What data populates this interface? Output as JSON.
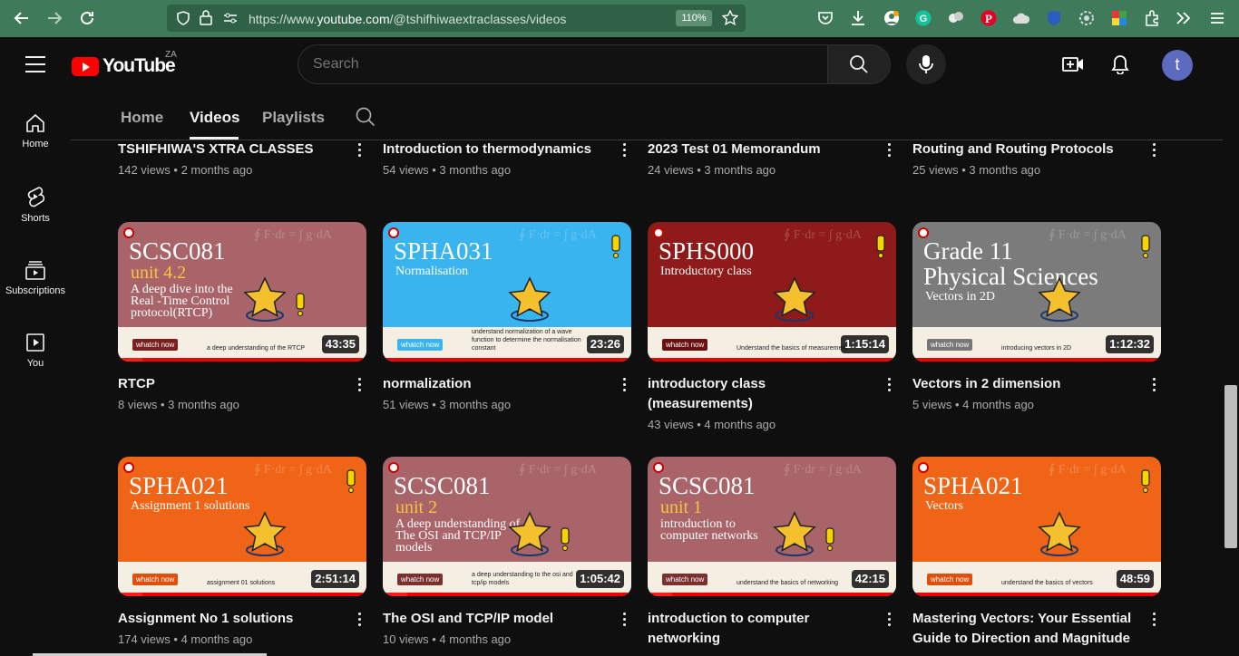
{
  "browser": {
    "url_prefix": "https://www.",
    "url_host": "youtube.com",
    "url_path": "/@tshifhiwaextraclasses/videos",
    "zoom": "110%"
  },
  "header": {
    "logo_text": "YouTube",
    "country": "ZA",
    "search_placeholder": "Search",
    "avatar_letter": "t"
  },
  "sidebar": {
    "items": [
      {
        "label": "Home",
        "icon": "home-icon"
      },
      {
        "label": "Shorts",
        "icon": "shorts-icon"
      },
      {
        "label": "Subscriptions",
        "icon": "subscriptions-icon"
      },
      {
        "label": "You",
        "icon": "you-icon"
      }
    ]
  },
  "tabs": [
    {
      "label": "Home",
      "active": false
    },
    {
      "label": "Videos",
      "active": true
    },
    {
      "label": "Playlists",
      "active": false
    }
  ],
  "top_row": [
    {
      "title": "TSHIFHIWA'S XTRA CLASSES",
      "meta": "142 views • 2 months ago"
    },
    {
      "title": "Introduction to thermodynamics",
      "meta": "54 views • 3 months ago"
    },
    {
      "title": "2023 Test 01 Memorandum",
      "meta": "24 views • 3 months ago"
    },
    {
      "title": "Routing and Routing Protocols",
      "meta": "25 views • 3 months ago"
    }
  ],
  "row2": [
    {
      "title": "RTCP",
      "meta": "8 views • 3 months ago",
      "duration": "43:35",
      "thumb": {
        "big": "SCSC081",
        "unit": "unit 4.2",
        "sub": "A deep dive into the\nReal -Time Control\nprotocol(RTCP)",
        "watch": "whatch now",
        "strip": "a deep understanding of the RTCP",
        "bg": "#a86468",
        "watch_bg": "#7a2020",
        "progress": 0.1
      }
    },
    {
      "title": "normalization",
      "meta": "51 views • 3 months ago",
      "duration": "23:26",
      "thumb": {
        "big": "SPHA031",
        "unit": "",
        "sub": "Normalisation",
        "watch": "whatch now",
        "strip": "understand normalization of a wave function to determine the normalisation constant",
        "bg": "#3ab4ef",
        "watch_bg": "#3ab4ef",
        "progress": 0
      }
    },
    {
      "title": "introductory class (measurements)",
      "meta": "43 views • 4 months ago",
      "duration": "1:15:14",
      "thumb": {
        "big": "SPHS000",
        "unit": "",
        "sub": "Introductory class",
        "watch": "whatch now",
        "strip": "Understand the basics of measurement",
        "bg": "#8e1a1a",
        "watch_bg": "#6a1010",
        "progress": 0
      }
    },
    {
      "title": "Vectors in 2 dimension",
      "meta": "5 views • 4 months ago",
      "duration": "1:12:32",
      "thumb": {
        "big": "Grade 11",
        "big2": "Physical Sciences",
        "unit": "",
        "sub": "Vectors in 2D",
        "watch": "whatch now",
        "strip": "introducing vectors in 2D",
        "bg": "#7b7b7b",
        "watch_bg": "#777777",
        "progress": 0
      }
    }
  ],
  "row3": [
    {
      "title": "Assignment No 1 solutions",
      "meta": "174 views • 4 months ago",
      "duration": "2:51:14",
      "thumb": {
        "big": "SPHA021",
        "unit": "",
        "sub": "Assignment 1 solutions",
        "watch": "whatch now",
        "strip": "assignment 01 solutions",
        "bg": "#f06418",
        "watch_bg": "#e0500c",
        "progress": 0.1
      }
    },
    {
      "title": "The OSI and TCP/IP model",
      "meta": "10 views • 4 months ago",
      "duration": "1:05:42",
      "thumb": {
        "big": "SCSC081",
        "unit": "unit 2",
        "sub": "A deep understanding of\nThe OSI and TCP/IP\nmodels",
        "watch": "whatch now",
        "strip": "a deep understanding to the osi and tcp/ip models",
        "bg": "#a86468",
        "watch_bg": "#7a3030",
        "progress": 0.1
      }
    },
    {
      "title": "introduction to computer networking",
      "meta": "",
      "duration": "42:15",
      "thumb": {
        "big": "SCSC081",
        "unit": "unit 1",
        "sub": "introduction to\ncomputer networks",
        "watch": "whatch now",
        "strip": "understand the basics of networking",
        "bg": "#a86468",
        "watch_bg": "#7a3030",
        "progress": 0.1
      }
    },
    {
      "title": "Mastering Vectors: Your Essential Guide to Direction and Magnitude",
      "meta": "",
      "duration": "48:59",
      "thumb": {
        "big": "SPHA021",
        "unit": "",
        "sub": "Vectors",
        "watch": "whatch now",
        "strip": "understand the basics of vectors",
        "bg": "#f06418",
        "watch_bg": "#e0500c",
        "progress": 0
      }
    }
  ]
}
